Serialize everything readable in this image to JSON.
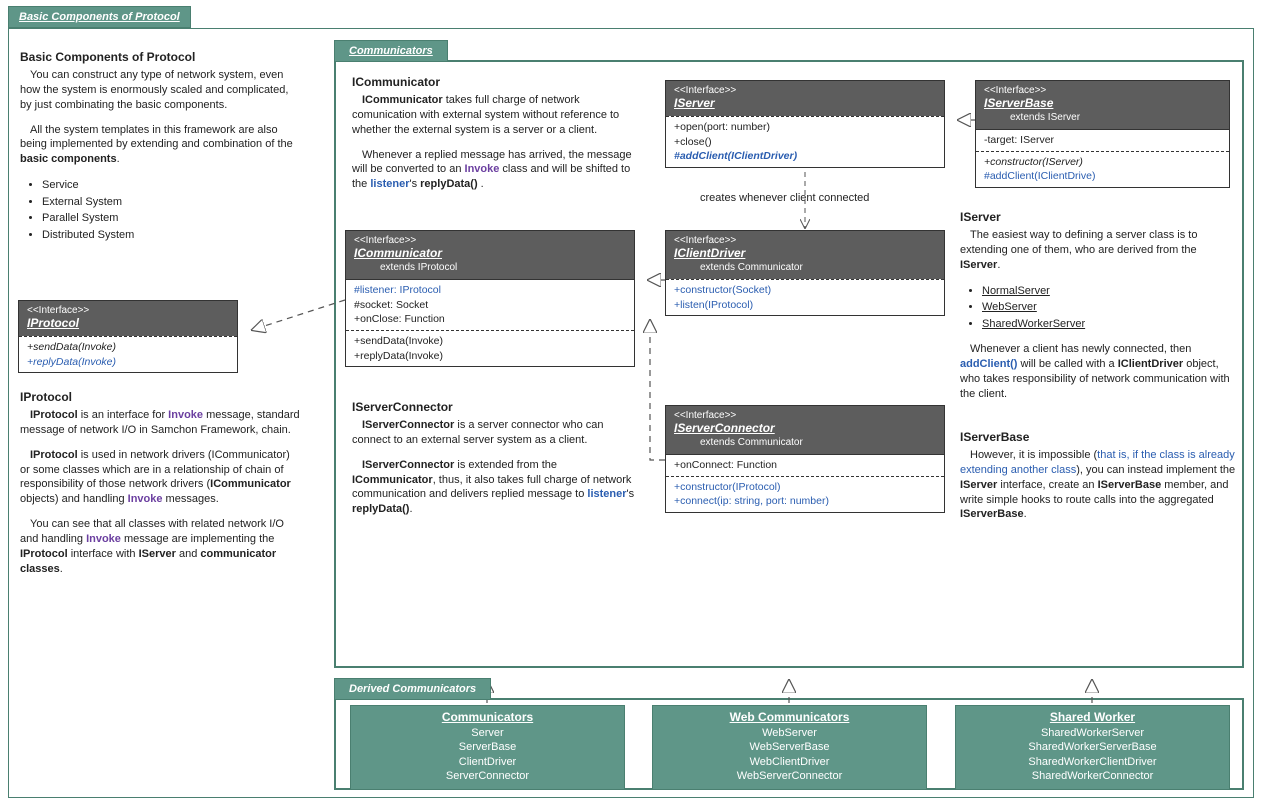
{
  "page_title": "Basic Components of Protocol",
  "left": {
    "title": "Basic Components of Protocol",
    "p1": "You can construct any type of network system, even how the system is enormously scaled and complicated, by just combinating the basic components.",
    "p2_pre": "All the system templates in this framework are also being implemented by extending and combination of the ",
    "p2_bold": "basic components",
    "p2_post": ".",
    "bullets": [
      "Service",
      "External System",
      "Parallel System",
      "Distributed System"
    ]
  },
  "iprotocol_box": {
    "stereo": "<<Interface>>",
    "name": "IProtocol",
    "rows": [
      "+sendData(Invoke)",
      "+replyData(Invoke)"
    ]
  },
  "iprotocol_desc": {
    "title": "IProtocol",
    "p1_a": "IProtocol",
    "p1_b": " is an interface for ",
    "p1_c": "Invoke",
    "p1_d": " message, standard message of network I/O in Samchon Framework, chain.",
    "p2_a": "IProtocol",
    "p2_b": " is used in network drivers (ICommunicator) or some classes which are in a relationship of chain of responsibility of those network drivers (",
    "p2_c": "ICommunicator",
    "p2_d": " objects) and handling ",
    "p2_e": "Invoke",
    "p2_f": " messages.",
    "p3_a": "You can see that all classes with related network I/O and handling ",
    "p3_b": "Invoke",
    "p3_c": " message are implementing the ",
    "p3_d": "IProtocol",
    "p3_e": " interface with ",
    "p3_f": "IServer",
    "p3_g": " and ",
    "p3_h": "communicator classes",
    "p3_i": "."
  },
  "communicators_tab": "Communicators",
  "icomm_desc": {
    "title": "ICommunicator",
    "p1_a": "ICommunicator",
    "p1_b": " takes full charge of network comunication with external system without reference to whether the external system is a server or a client.",
    "p2_a": "Whenever a replied message has arrived, the message will be converted to an ",
    "p2_b": "Invoke",
    "p2_c": " class and will be shifted to the ",
    "p2_d": "listener",
    "p2_e": "'s ",
    "p2_f": "replyData()",
    "p2_g": " ."
  },
  "icomm_box": {
    "stereo": "<<Interface>>",
    "name": "ICommunicator",
    "ext": "extends IProtocol",
    "attrs": [
      "#listener: IProtocol",
      "#socket: Socket",
      "+onClose: Function"
    ],
    "ops": [
      "+sendData(Invoke)",
      "+replyData(Invoke)"
    ]
  },
  "iserverconn_desc": {
    "title": "IServerConnector",
    "p1_a": "IServerConnector",
    "p1_b": " is a server connector who can connect to an external server system as a client.",
    "p2_a": "IServerConnector",
    "p2_b": " is extended from the ",
    "p2_c": "ICommunicator",
    "p2_d": ", thus, it also takes full charge of network communication and delivers replied message to ",
    "p2_e": "listener",
    "p2_f": "'s ",
    "p2_g": "replyData()",
    "p2_h": "."
  },
  "iserver_box": {
    "stereo": "<<Interface>>",
    "name": "IServer",
    "rows": [
      "+open(port: number)",
      "+close()",
      "#addClient(IClientDriver)"
    ]
  },
  "creates_label": "creates whenever client connected",
  "iclientdriver_box": {
    "stereo": "<<Interface>>",
    "name": "IClientDriver",
    "ext": "extends Communicator",
    "ops": [
      "+constructor(Socket)",
      "+listen(IProtocol)"
    ]
  },
  "iserverconn_box": {
    "stereo": "<<Interface>>",
    "name": "IServerConnector",
    "ext": "extends Communicator",
    "attrs": [
      "+onConnect: Function"
    ],
    "ops": [
      "+constructor(IProtocol)",
      "+connect(ip: string, port: number)"
    ]
  },
  "iserverbase_box": {
    "stereo": "<<Interface>>",
    "name": "IServerBase",
    "ext": "extends IServer",
    "attrs": [
      "-target: IServer"
    ],
    "ops": [
      "+constructor(IServer)",
      "#addClient(IClientDrive)"
    ]
  },
  "iserver_desc": {
    "title": "IServer",
    "p1_a": "The easiest way to defining a server class is to extending one of them, who are derived from the ",
    "p1_b": "IServer",
    "p1_c": ".",
    "bullets": [
      "NormalServer",
      "WebServer",
      "SharedWorkerServer"
    ],
    "p2_a": "Whenever a client has newly connected, then ",
    "p2_b": "addClient()",
    "p2_c": " will be called with a ",
    "p2_d": "IClientDriver",
    "p2_e": " object, who takes responsibility of network communication with the client."
  },
  "iserverbase_desc": {
    "title": "IServerBase",
    "p1_a": "However, it is impossible (",
    "p1_b": "that is, if the class is already extending another class",
    "p1_c": "), you can instead implement the ",
    "p1_d": "IServer",
    "p1_e": " interface, create an ",
    "p1_f": "IServerBase",
    "p1_g": " member, and write simple hooks to route calls into the aggregated ",
    "p1_h": "IServerBase",
    "p1_i": "."
  },
  "derived_tab": "Derived Communicators",
  "derived": [
    {
      "title": "Communicators",
      "items": [
        "Server",
        "ServerBase",
        "ClientDriver",
        "ServerConnector"
      ]
    },
    {
      "title": "Web Communicators",
      "items": [
        "WebServer",
        "WebServerBase",
        "WebClientDriver",
        "WebServerConnector"
      ]
    },
    {
      "title": "Shared Worker",
      "items": [
        "SharedWorkerServer",
        "SharedWorkerServerBase",
        "SharedWorkerClientDriver",
        "SharedWorkerConnector"
      ]
    }
  ]
}
